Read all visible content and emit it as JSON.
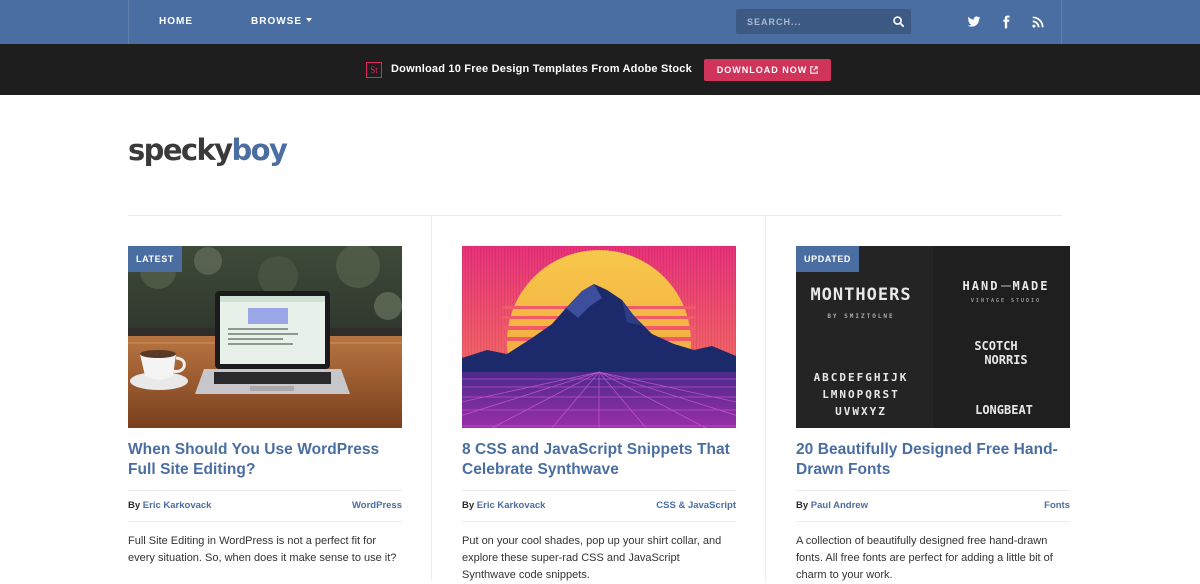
{
  "nav": {
    "home": "HOME",
    "browse": "BROWSE",
    "search_placeholder": "SEARCH..."
  },
  "social": [
    "twitter-icon",
    "facebook-icon",
    "rss-icon"
  ],
  "promo": {
    "badge": "St",
    "text": "Download 10 Free Design Templates From Adobe Stock",
    "button": "DOWNLOAD NOW"
  },
  "logo": {
    "part1": "specky",
    "part2": "boy"
  },
  "colors": {
    "brand": "#4a6ea1",
    "promo_bg": "#1e1e1e",
    "accent": "#d1345b"
  },
  "cards": [
    {
      "badge": "LATEST",
      "title": "When Should You Use WordPress Full Site Editing?",
      "by": "By",
      "author": "Eric Karkovack",
      "category": "WordPress",
      "excerpt": "Full Site Editing in WordPress is not a perfect fit for every situation. So, when does it make sense to use it?"
    },
    {
      "title": "8 CSS and JavaScript Snippets That Celebrate Synthwave",
      "by": "By",
      "author": "Eric Karkovack",
      "category": "CSS & JavaScript",
      "excerpt": "Put on your cool shades, pop up your shirt collar, and explore these super-rad CSS and JavaScript Synthwave code snippets."
    },
    {
      "badge": "UPDATED",
      "title": "20 Beautifully Designed Free Hand-Drawn Fonts",
      "by": "By",
      "author": "Paul Andrew",
      "category": "Fonts",
      "excerpt": "A collection of beautifully designed free hand-drawn fonts. All free fonts are perfect for adding a little bit of charm to your work.",
      "image_text": {
        "f1": "MONTHOERS",
        "f1_sub": "BY SMIZTOLNE",
        "f2a": "HAND",
        "f2b": "MADE",
        "f2_sub": "VINTAGE STUDIO",
        "f3a": "SCOTCH",
        "f3b": "NORRIS",
        "alpha1": "ABCDEFGHIJK",
        "alpha2": "LMNOPQRST",
        "alpha3": "UVWXYZ",
        "f4": "LONGBEAT"
      }
    }
  ]
}
